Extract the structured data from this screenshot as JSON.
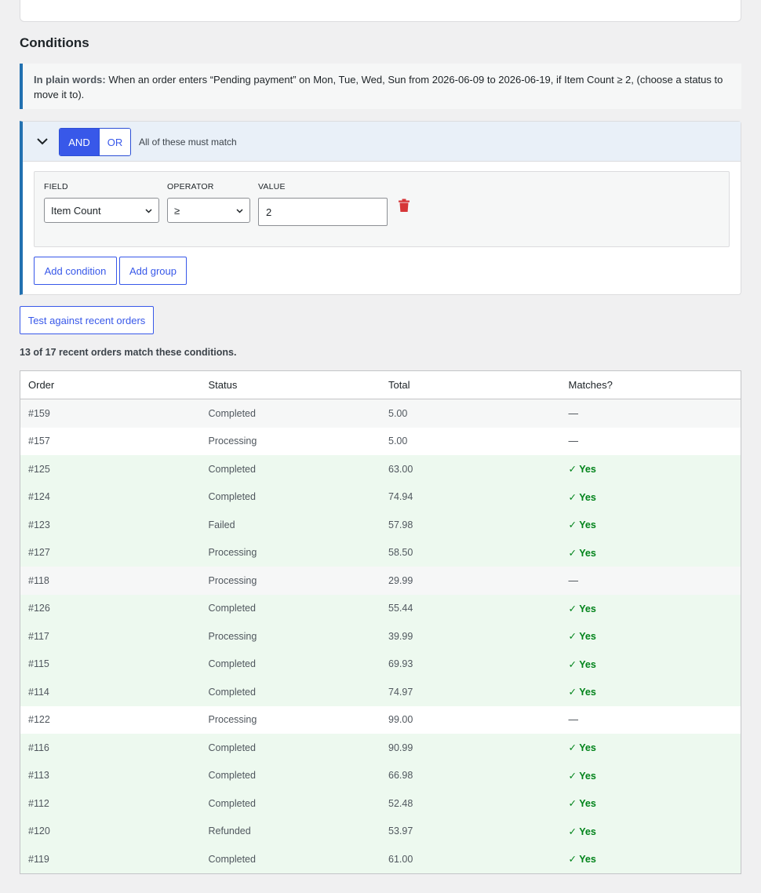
{
  "section_title": "Conditions",
  "plain_words": {
    "label": "In plain words:",
    "text": "When an order enters “Pending payment” on Mon, Tue, Wed, Sun from 2026-06-09 to 2026-06-19, if Item Count ≥ 2, (choose a status to move it to)."
  },
  "group": {
    "and_label": "AND",
    "or_label": "OR",
    "match_text": "All of these must match",
    "condition": {
      "field_label": "FIELD",
      "operator_label": "OPERATOR",
      "value_label": "VALUE",
      "field_value": "Item Count",
      "operator_value": "≥",
      "value": "2"
    },
    "add_condition_label": "Add condition",
    "add_group_label": "Add group"
  },
  "test_button_label": "Test against recent orders",
  "summary_text": "13 of 17 recent orders match these conditions.",
  "table": {
    "headers": [
      "Order",
      "Status",
      "Total",
      "Matches?"
    ],
    "rows": [
      {
        "order": "#159",
        "status": "Completed",
        "total": "5.00",
        "match": "—"
      },
      {
        "order": "#157",
        "status": "Processing",
        "total": "5.00",
        "match": "—"
      },
      {
        "order": "#125",
        "status": "Completed",
        "total": "63.00",
        "match": "✓ Yes"
      },
      {
        "order": "#124",
        "status": "Completed",
        "total": "74.94",
        "match": "✓ Yes"
      },
      {
        "order": "#123",
        "status": "Failed",
        "total": "57.98",
        "match": "✓ Yes"
      },
      {
        "order": "#127",
        "status": "Processing",
        "total": "58.50",
        "match": "✓ Yes"
      },
      {
        "order": "#118",
        "status": "Processing",
        "total": "29.99",
        "match": "—"
      },
      {
        "order": "#126",
        "status": "Completed",
        "total": "55.44",
        "match": "✓ Yes"
      },
      {
        "order": "#117",
        "status": "Processing",
        "total": "39.99",
        "match": "✓ Yes"
      },
      {
        "order": "#115",
        "status": "Completed",
        "total": "69.93",
        "match": "✓ Yes"
      },
      {
        "order": "#114",
        "status": "Completed",
        "total": "74.97",
        "match": "✓ Yes"
      },
      {
        "order": "#122",
        "status": "Processing",
        "total": "99.00",
        "match": "—"
      },
      {
        "order": "#116",
        "status": "Completed",
        "total": "90.99",
        "match": "✓ Yes"
      },
      {
        "order": "#113",
        "status": "Completed",
        "total": "66.98",
        "match": "✓ Yes"
      },
      {
        "order": "#112",
        "status": "Completed",
        "total": "52.48",
        "match": "✓ Yes"
      },
      {
        "order": "#120",
        "status": "Refunded",
        "total": "53.97",
        "match": "✓ Yes"
      },
      {
        "order": "#119",
        "status": "Completed",
        "total": "61.00",
        "match": "✓ Yes"
      }
    ]
  },
  "colors": {
    "accent": "#3858e9",
    "border_accent": "#2271b1",
    "match_green": "#00831a",
    "match_row_bg": "#edf9ef",
    "delete_red": "#d63638"
  }
}
